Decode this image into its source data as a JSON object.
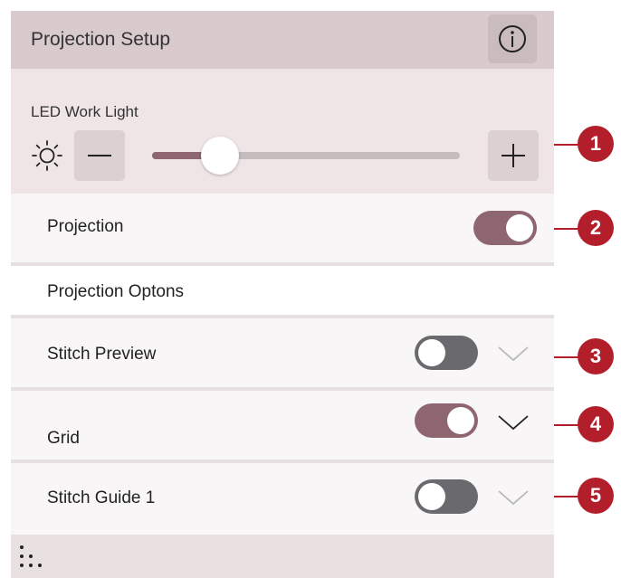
{
  "header": {
    "title": "Projection Setup",
    "info_icon": "info-icon"
  },
  "led": {
    "label": "LED Work Light",
    "icon": "sun-icon",
    "level": 0.22,
    "minus_icon": "minus-icon",
    "plus_icon": "plus-icon"
  },
  "projection": {
    "label": "Projection",
    "on": true
  },
  "options": {
    "title": "Projection Optons",
    "items": [
      {
        "label": "Stitch Preview",
        "on": false,
        "expand_enabled": false
      },
      {
        "label": "Grid",
        "on": true,
        "expand_enabled": true
      },
      {
        "label": "Stitch Guide 1",
        "on": false,
        "expand_enabled": false
      }
    ]
  },
  "footer": {
    "icon": "grip-icon"
  },
  "callouts": [
    "1",
    "2",
    "3",
    "4",
    "5"
  ],
  "colors": {
    "accent": "#8e6670",
    "toggle_off": "#6a6a6e",
    "callout": "#b31e2b",
    "header_bg": "#d8cacd",
    "led_bg": "#efe5e6"
  }
}
